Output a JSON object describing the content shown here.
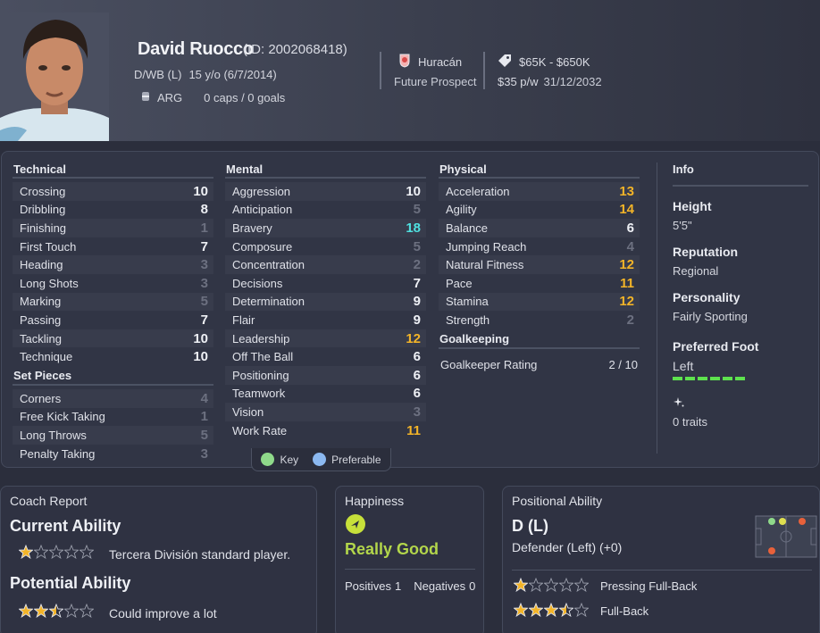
{
  "player": {
    "name": "David Ruocco",
    "id_text": "(ID: 2002068418)",
    "position": "D/WB (L)",
    "age_dob": "15 y/o (6/7/2014)",
    "nation": "ARG",
    "caps_goals": "0 caps / 0 goals",
    "club": "Huracán",
    "status": "Future Prospect",
    "value": "$65K - $650K",
    "wage": "$35 p/w",
    "contract_end": "31/12/2032"
  },
  "technical": {
    "title": "Technical",
    "rows": [
      {
        "label": "Crossing",
        "value": "10",
        "tone": "white"
      },
      {
        "label": "Dribbling",
        "value": "8",
        "tone": "white"
      },
      {
        "label": "Finishing",
        "value": "1",
        "tone": "grey"
      },
      {
        "label": "First Touch",
        "value": "7",
        "tone": "white"
      },
      {
        "label": "Heading",
        "value": "3",
        "tone": "grey"
      },
      {
        "label": "Long Shots",
        "value": "3",
        "tone": "grey"
      },
      {
        "label": "Marking",
        "value": "5",
        "tone": "grey"
      },
      {
        "label": "Passing",
        "value": "7",
        "tone": "white"
      },
      {
        "label": "Tackling",
        "value": "10",
        "tone": "white"
      },
      {
        "label": "Technique",
        "value": "10",
        "tone": "white"
      }
    ]
  },
  "set_pieces": {
    "title": "Set Pieces",
    "rows": [
      {
        "label": "Corners",
        "value": "4",
        "tone": "grey"
      },
      {
        "label": "Free Kick Taking",
        "value": "1",
        "tone": "grey"
      },
      {
        "label": "Long Throws",
        "value": "5",
        "tone": "grey"
      },
      {
        "label": "Penalty Taking",
        "value": "3",
        "tone": "grey"
      }
    ]
  },
  "mental": {
    "title": "Mental",
    "rows": [
      {
        "label": "Aggression",
        "value": "10",
        "tone": "white"
      },
      {
        "label": "Anticipation",
        "value": "5",
        "tone": "grey"
      },
      {
        "label": "Bravery",
        "value": "18",
        "tone": "cyan"
      },
      {
        "label": "Composure",
        "value": "5",
        "tone": "grey"
      },
      {
        "label": "Concentration",
        "value": "2",
        "tone": "grey"
      },
      {
        "label": "Decisions",
        "value": "7",
        "tone": "white"
      },
      {
        "label": "Determination",
        "value": "9",
        "tone": "white"
      },
      {
        "label": "Flair",
        "value": "9",
        "tone": "white"
      },
      {
        "label": "Leadership",
        "value": "12",
        "tone": "orange"
      },
      {
        "label": "Off The Ball",
        "value": "6",
        "tone": "white"
      },
      {
        "label": "Positioning",
        "value": "6",
        "tone": "white"
      },
      {
        "label": "Teamwork",
        "value": "6",
        "tone": "white"
      },
      {
        "label": "Vision",
        "value": "3",
        "tone": "grey"
      },
      {
        "label": "Work Rate",
        "value": "11",
        "tone": "orange"
      }
    ]
  },
  "physical": {
    "title": "Physical",
    "rows": [
      {
        "label": "Acceleration",
        "value": "13",
        "tone": "orange"
      },
      {
        "label": "Agility",
        "value": "14",
        "tone": "orange"
      },
      {
        "label": "Balance",
        "value": "6",
        "tone": "white"
      },
      {
        "label": "Jumping Reach",
        "value": "4",
        "tone": "grey"
      },
      {
        "label": "Natural Fitness",
        "value": "12",
        "tone": "orange"
      },
      {
        "label": "Pace",
        "value": "11",
        "tone": "orange"
      },
      {
        "label": "Stamina",
        "value": "12",
        "tone": "orange"
      },
      {
        "label": "Strength",
        "value": "2",
        "tone": "grey"
      }
    ]
  },
  "goalkeeping": {
    "title": "Goalkeeping",
    "label": "Goalkeeper Rating",
    "value": "2 / 10"
  },
  "info": {
    "title": "Info",
    "height_label": "Height",
    "height": "5'5\"",
    "reputation_label": "Reputation",
    "reputation": "Regional",
    "personality_label": "Personality",
    "personality": "Fairly Sporting",
    "foot_label": "Preferred Foot",
    "foot": "Left",
    "traits": "0 traits"
  },
  "legend": {
    "key": "Key",
    "preferable": "Preferable",
    "key_color": "#8fd98a",
    "preferable_color": "#8bb8f0"
  },
  "coach": {
    "title": "Coach Report",
    "current_label": "Current Ability",
    "current_text": "Tercera División standard player.",
    "current_stars": 1,
    "potential_label": "Potential Ability",
    "potential_text": "Could improve a lot",
    "potential_stars": 2.5
  },
  "happiness": {
    "title": "Happiness",
    "status": "Really Good",
    "positives_label": "Positives",
    "positives": "1",
    "negatives_label": "Negatives",
    "negatives": "0"
  },
  "positional": {
    "title": "Positional Ability",
    "position": "D (L)",
    "description": "Defender (Left) (+0)",
    "roles": [
      {
        "label": "Pressing Full-Back",
        "stars": 1
      },
      {
        "label": "Full-Back",
        "stars": 3.5
      }
    ]
  },
  "colors": {
    "grey": "#6c7080",
    "white": "#eef0f5",
    "orange": "#f3b428",
    "cyan": "#4fe0e0",
    "star_gold": "#f3b428",
    "star_white": "#e3e5ec",
    "happy_green": "#b3d64b"
  }
}
